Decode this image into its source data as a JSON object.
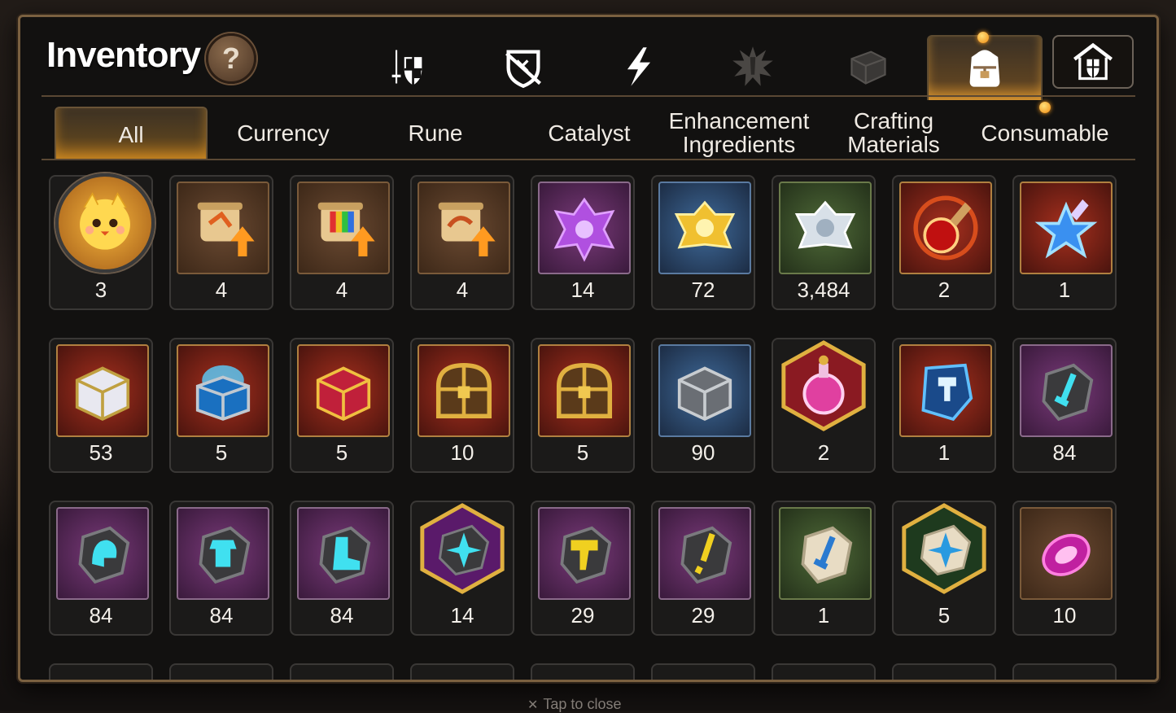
{
  "title": "Inventory",
  "help_label": "?",
  "category_tabs": [
    {
      "icon": "sword-shield-icon",
      "active": false
    },
    {
      "icon": "broken-shield-icon",
      "active": false
    },
    {
      "icon": "lightning-icon",
      "active": false
    },
    {
      "icon": "splat-icon",
      "active": false
    },
    {
      "icon": "cube-icon",
      "active": false
    },
    {
      "icon": "backpack-icon",
      "active": true
    },
    {
      "icon": "house-shield-icon",
      "active": false
    }
  ],
  "sub_tabs": [
    "All",
    "Currency",
    "Rune",
    "Catalyst",
    "Enhancement Ingredients",
    "Crafting Materials",
    "Consumable"
  ],
  "active_sub_tab": "All",
  "items": [
    {
      "icon": "mascot-coin-icon",
      "qty": "3"
    },
    {
      "icon": "scroll-upgrade-icon",
      "qty": "4"
    },
    {
      "icon": "rainbow-scroll-upgrade-icon",
      "qty": "4"
    },
    {
      "icon": "scroll-upgrade-icon",
      "qty": "4"
    },
    {
      "icon": "purple-crystal-icon",
      "qty": "14"
    },
    {
      "icon": "gold-crystal-icon",
      "qty": "72"
    },
    {
      "icon": "silver-crystal-icon",
      "qty": "3,484"
    },
    {
      "icon": "red-potion-icon",
      "qty": "2"
    },
    {
      "icon": "blue-star-potion-icon",
      "qty": "1"
    },
    {
      "icon": "silver-chest-icon",
      "qty": "53"
    },
    {
      "icon": "blue-chest-icon",
      "qty": "5"
    },
    {
      "icon": "red-chest-icon",
      "qty": "5"
    },
    {
      "icon": "gold-chest-icon",
      "qty": "10"
    },
    {
      "icon": "gold-chest-icon",
      "qty": "5"
    },
    {
      "icon": "gray-cube-icon",
      "qty": "90"
    },
    {
      "icon": "pink-potion-icon",
      "qty": "2"
    },
    {
      "icon": "hammer-rune-icon",
      "qty": "1"
    },
    {
      "icon": "sword-stone-icon",
      "qty": "84"
    },
    {
      "icon": "helmet-stone-icon",
      "qty": "84"
    },
    {
      "icon": "armor-stone-icon",
      "qty": "84"
    },
    {
      "icon": "boot-stone-icon",
      "qty": "84"
    },
    {
      "icon": "star-stone-icon",
      "qty": "14"
    },
    {
      "icon": "hammer-stone-icon",
      "qty": "29"
    },
    {
      "icon": "bolt-stone-icon",
      "qty": "29"
    },
    {
      "icon": "blade-stone-icon",
      "qty": "1"
    },
    {
      "icon": "star-stone-icon",
      "qty": "5"
    },
    {
      "icon": "pink-gem-icon",
      "qty": "10"
    }
  ],
  "bottom_hint": "Tap to close",
  "colors": {
    "accent": "#b57a28",
    "frame": "#7a6040"
  }
}
